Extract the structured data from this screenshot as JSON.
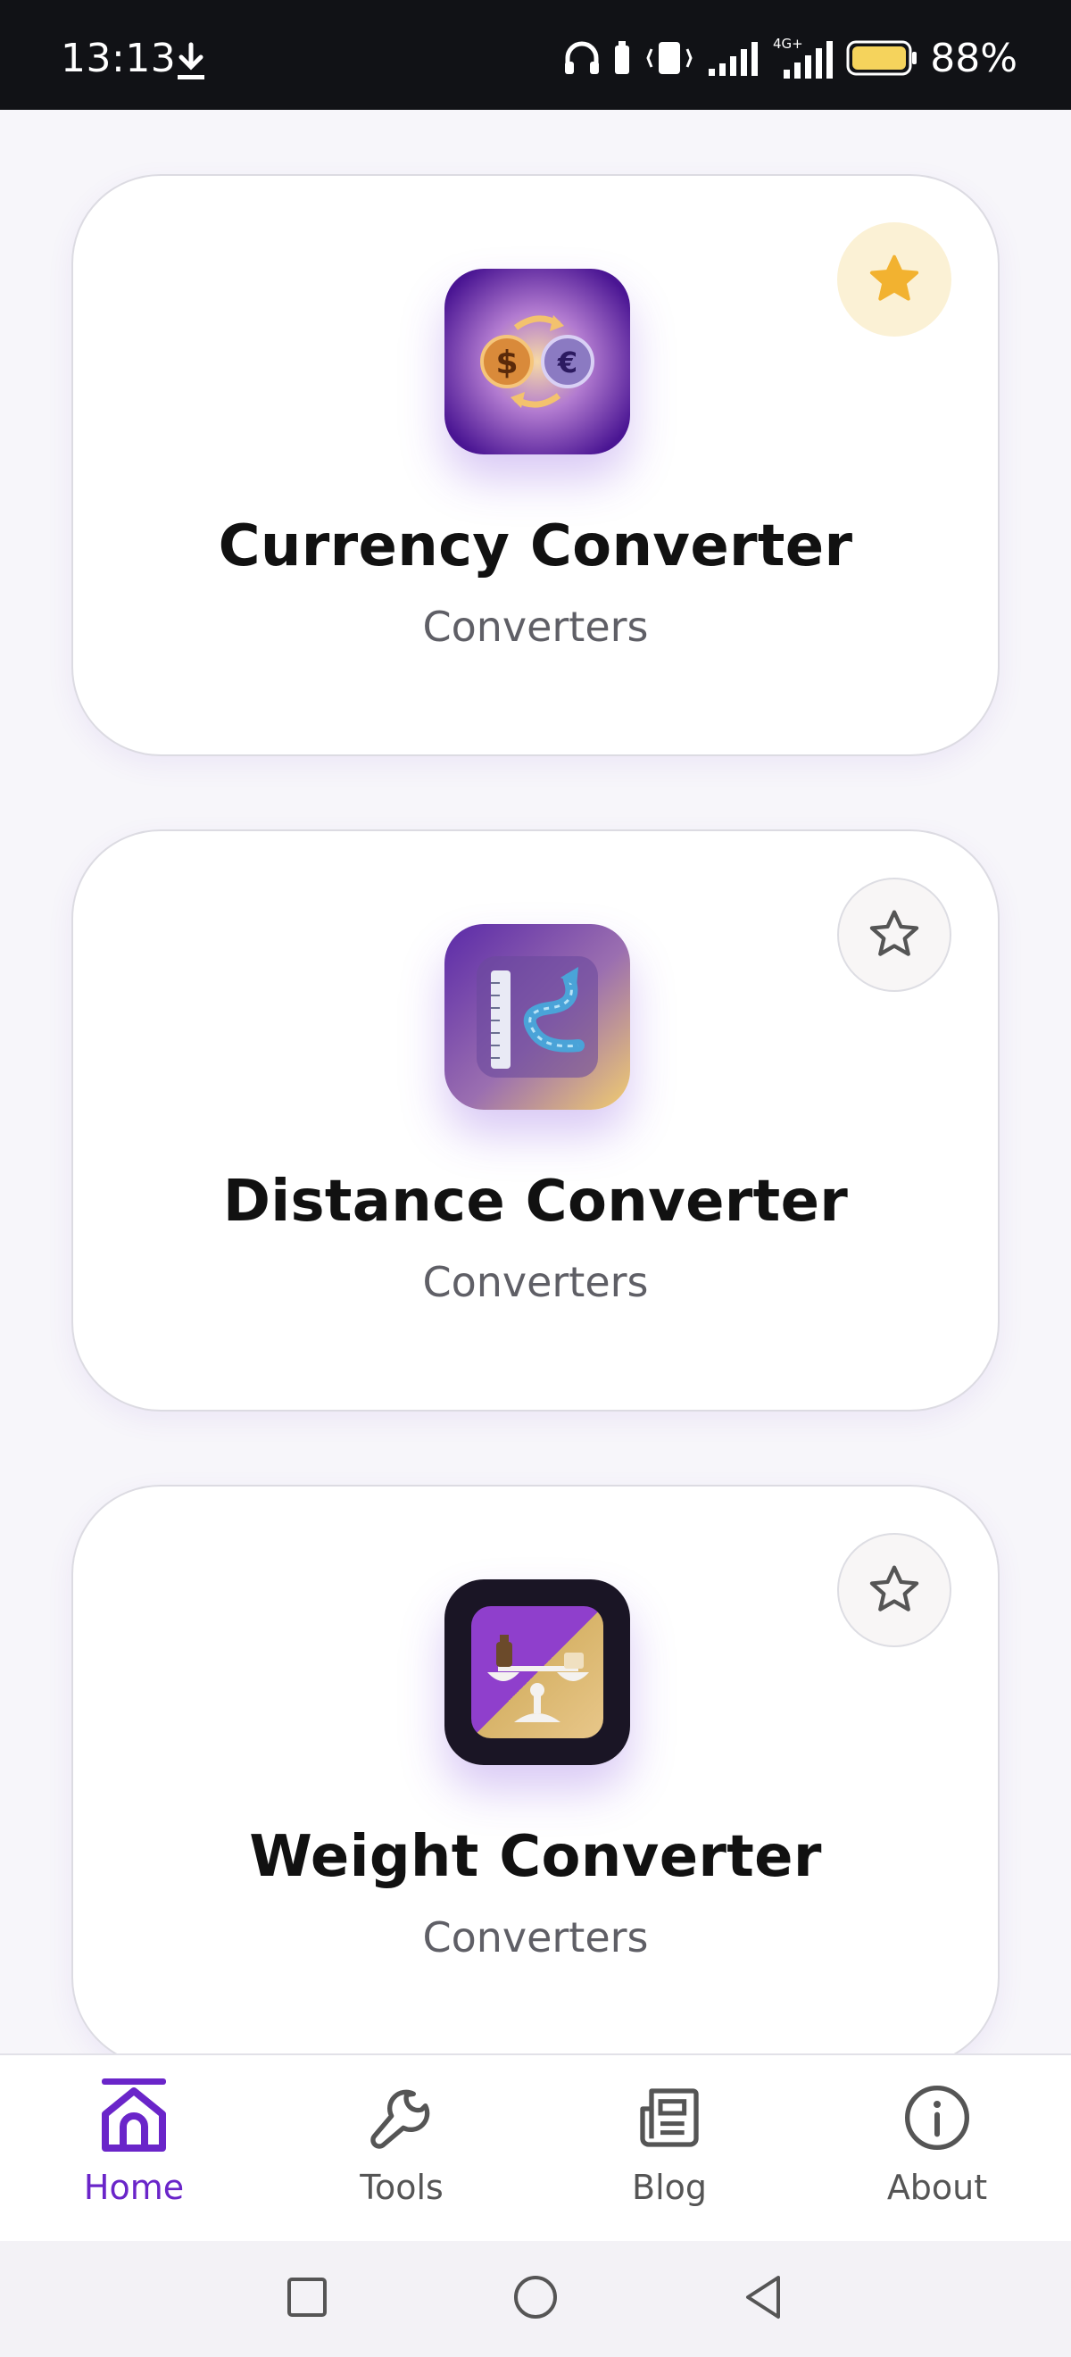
{
  "status_bar": {
    "time": "13:13",
    "battery": "88%",
    "network_label": "4G+"
  },
  "cards": [
    {
      "title": "Currency Converter",
      "category": "Converters",
      "favorited": true
    },
    {
      "title": "Distance Converter",
      "category": "Converters",
      "favorited": false
    },
    {
      "title": "Weight Converter",
      "category": "Converters",
      "favorited": false
    }
  ],
  "bottom_nav": {
    "items": [
      {
        "label": "Home",
        "icon": "home-icon",
        "active": true
      },
      {
        "label": "Tools",
        "icon": "wrench-icon",
        "active": false
      },
      {
        "label": "Blog",
        "icon": "newspaper-icon",
        "active": false
      },
      {
        "label": "About",
        "icon": "info-icon",
        "active": false
      }
    ]
  },
  "colors": {
    "accent": "#6a25c9",
    "star_active": "#f2b230",
    "star_bg": "#fbf1d5",
    "status_bar": "#111216"
  }
}
